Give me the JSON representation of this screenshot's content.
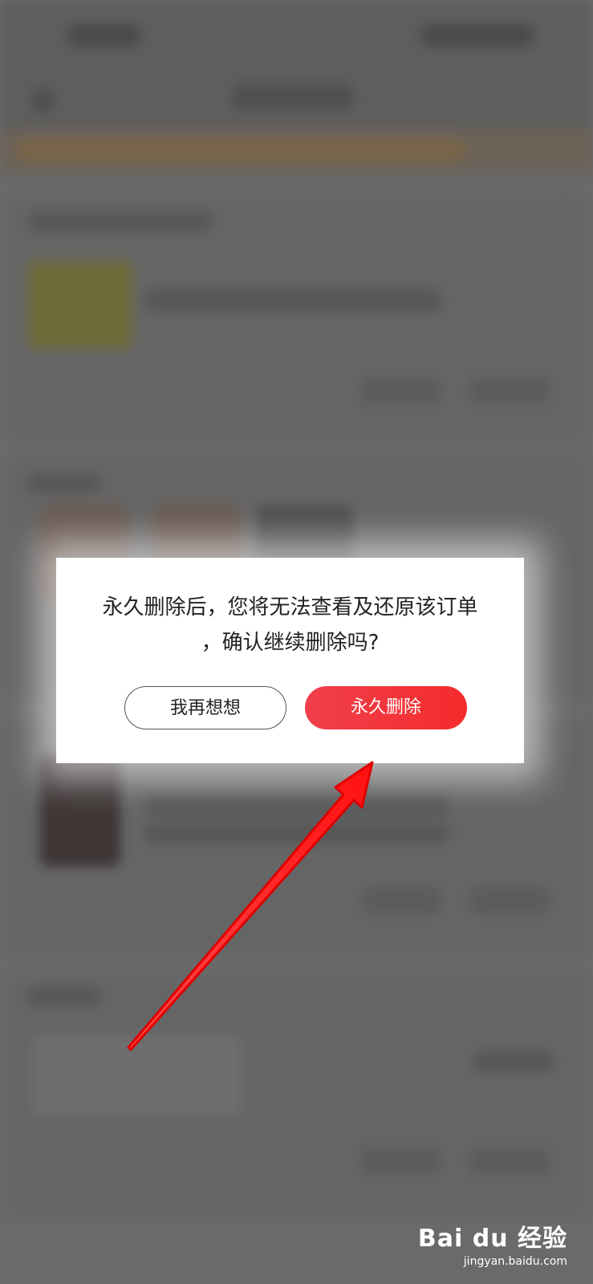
{
  "dialog": {
    "message": "永久删除后，您将无法查看及还原该订单\n，确认继续删除吗?",
    "cancel_label": "我再想想",
    "confirm_label": "永久删除"
  },
  "watermark": {
    "logo": "Bai du 经验",
    "url": "jingyan.baidu.com"
  },
  "colors": {
    "overlay": "#6a6a6a",
    "confirm_accent": "#f0404c",
    "arrow": "#ff1e1e"
  }
}
